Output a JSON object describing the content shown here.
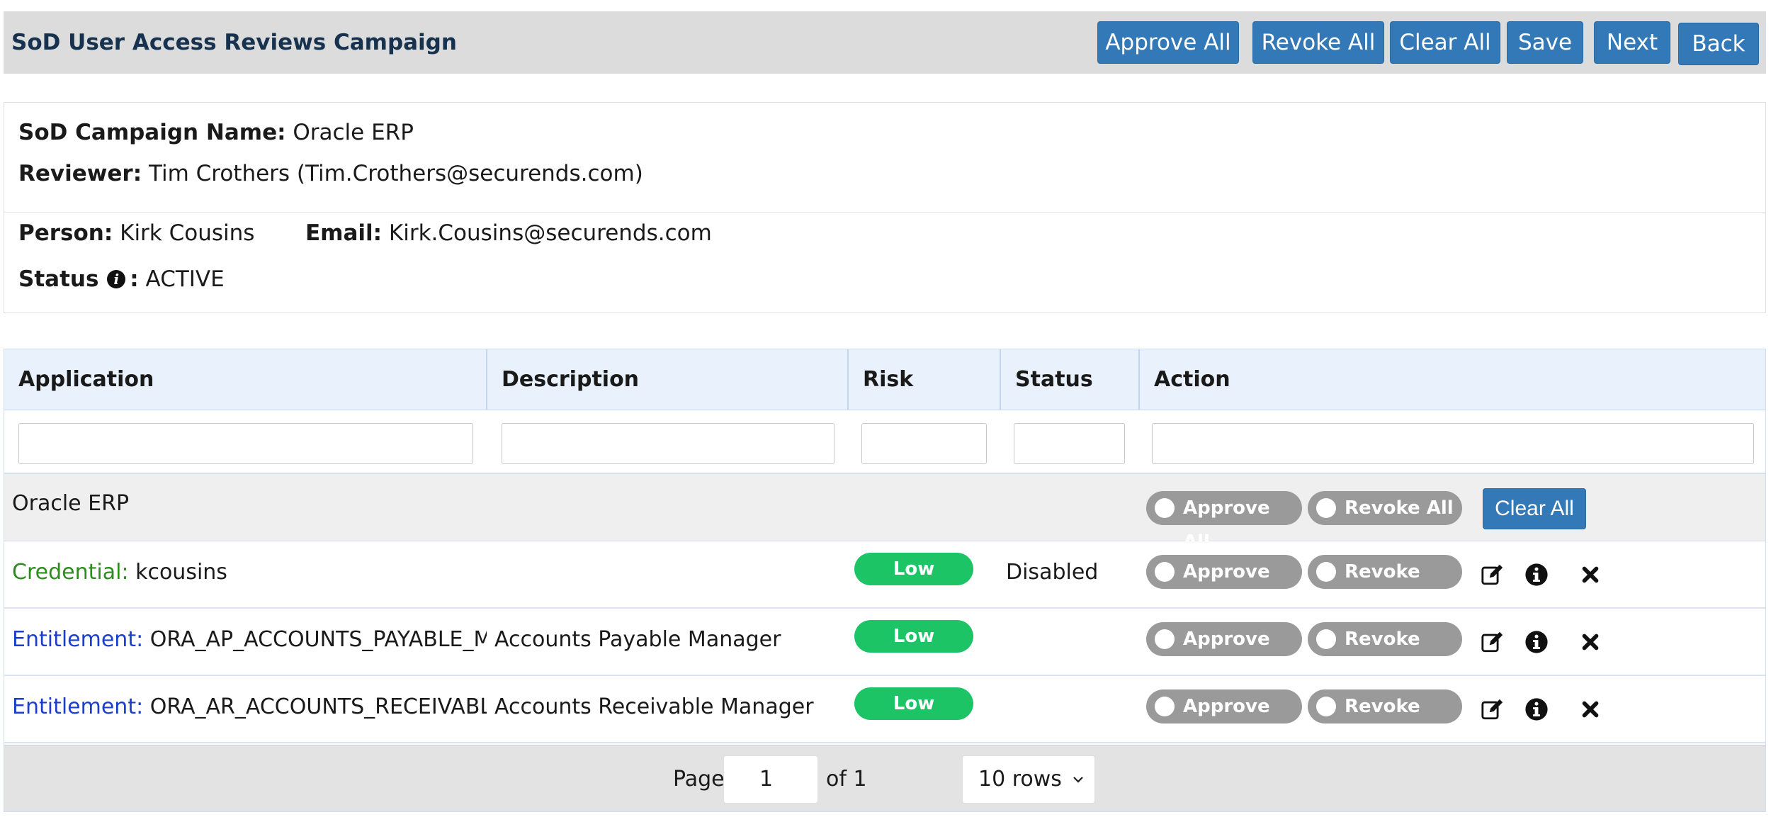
{
  "header": {
    "title": "SoD User Access Reviews Campaign",
    "buttons": {
      "approve_all": "Approve All",
      "revoke_all": "Revoke All",
      "clear_all": "Clear All",
      "save": "Save",
      "next": "Next",
      "back": "Back"
    }
  },
  "campaign": {
    "name_label": "SoD Campaign Name:",
    "name_value": "Oracle ERP",
    "reviewer_label": "Reviewer:",
    "reviewer_value": "Tim Crothers (Tim.Crothers@securends.com)",
    "person_label": "Person:",
    "person_value": "Kirk Cousins",
    "email_label": "Email:",
    "email_value": "Kirk.Cousins@securends.com",
    "status_label": "Status",
    "status_sep": ":",
    "status_value": "ACTIVE",
    "info_icon": "info-icon"
  },
  "table": {
    "columns": [
      "Application",
      "Description",
      "Risk",
      "Status",
      "Action"
    ],
    "group": {
      "name": "Oracle ERP",
      "approve_all": "Approve All",
      "revoke_all": "Revoke All",
      "clear_all": "Clear All"
    },
    "rows": [
      {
        "type_label": "Credential:",
        "value": "kcousins",
        "description": "",
        "risk": "Low",
        "status": "Disabled",
        "approve": "Approve",
        "revoke": "Revoke"
      },
      {
        "type_label": "Entitlement:",
        "value": "ORA_AP_ACCOUNTS_PAYABLE_MANAGER_JOB",
        "description": "Accounts Payable Manager",
        "risk": "Low",
        "status": "",
        "approve": "Approve",
        "revoke": "Revoke"
      },
      {
        "type_label": "Entitlement:",
        "value": "ORA_AR_ACCOUNTS_RECEIVABLE_MANAGER_JOB",
        "description": "Accounts Receivable Manager",
        "risk": "Low",
        "status": "",
        "approve": "Approve",
        "revoke": "Revoke"
      }
    ],
    "row_icons": [
      "edit-icon",
      "info-icon",
      "close-icon"
    ]
  },
  "pager": {
    "page_label": "Page",
    "page_value": "1",
    "of_label": "of 1",
    "rows_option": "10 rows"
  },
  "colors": {
    "primary_button": "#3379b7",
    "risk_low": "#1cc466",
    "credential_label": "#2e8b1f",
    "entitlement_label": "#1b3fc9",
    "toggle_off": "#9a9a9a"
  }
}
